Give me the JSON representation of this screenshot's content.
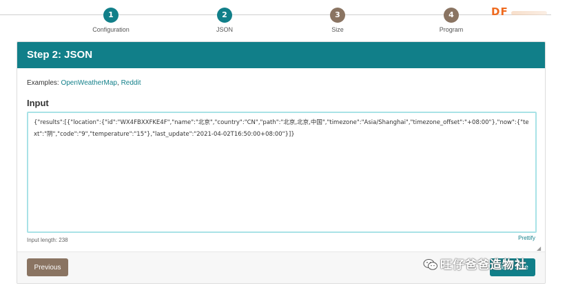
{
  "stepper": {
    "steps": [
      {
        "number": "1",
        "label": "Configuration",
        "state": "active"
      },
      {
        "number": "2",
        "label": "JSON",
        "state": "active"
      },
      {
        "number": "3",
        "label": "Size",
        "state": "inactive"
      },
      {
        "number": "4",
        "label": "Program",
        "state": "inactive"
      }
    ]
  },
  "brand": {
    "logo_text": "DF"
  },
  "card": {
    "title": "Step 2: JSON",
    "examples_prefix": "Examples: ",
    "examples": [
      "OpenWeatherMap",
      "Reddit"
    ],
    "examples_separator": ", ",
    "input_heading": "Input",
    "input_value": "{\"results\":[{\"location\":{\"id\":\"WX4FBXXFKE4F\",\"name\":\"北京\",\"country\":\"CN\",\"path\":\"北京,北京,中国\",\"timezone\":\"Asia/Shanghai\",\"timezone_offset\":\"+08:00\"},\"now\":{\"text\":\"阴\",\"code\":\"9\",\"temperature\":\"15\"},\"last_update\":\"2021-04-02T16:50:00+08:00\"}]}",
    "input_length_label": "Input length: 238",
    "prettify_label": "Prettify"
  },
  "footer": {
    "previous_label": "Previous",
    "next_label": "Next: Size"
  },
  "watermark": {
    "text": "旺仔爸爸造物社"
  },
  "colors": {
    "primary": "#117f89",
    "secondary": "#8a7462",
    "input_focus": "#a8e2e6",
    "logo": "#ef6a1e"
  }
}
